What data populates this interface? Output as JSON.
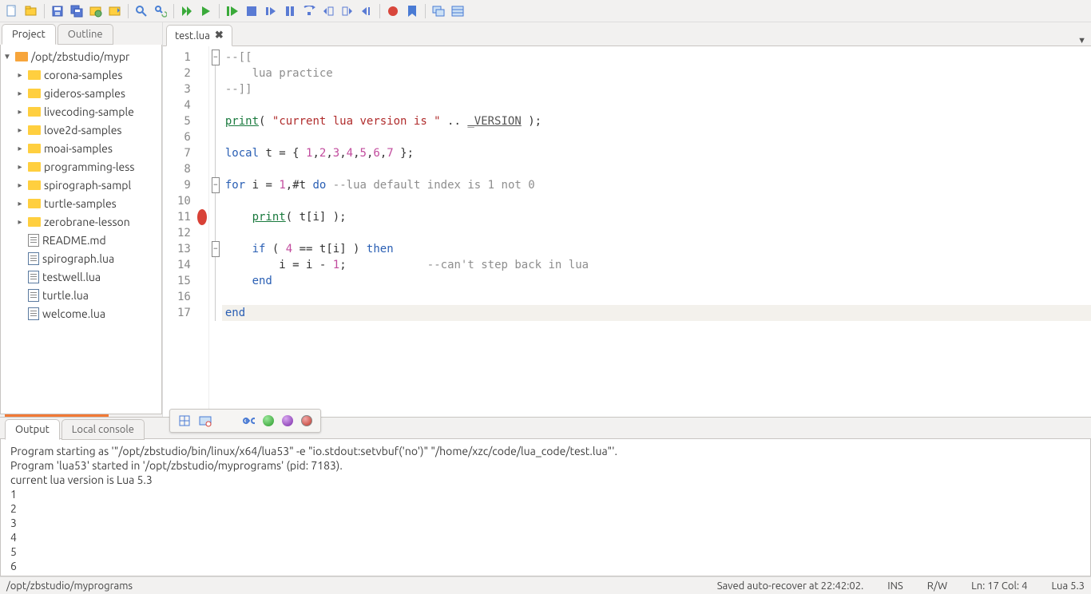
{
  "toolbar_icons": [
    "new-file",
    "open",
    "save",
    "save-all",
    "project",
    "recent",
    "find",
    "find-replace",
    "run",
    "run-no-debug",
    "debug",
    "stop",
    "step-over",
    "step-into",
    "step-out",
    "run-to",
    "toggle-breakpoint",
    "stack",
    "watch",
    "record",
    "bookmark",
    "split",
    "console"
  ],
  "sidebar": {
    "tabs": [
      "Project",
      "Outline"
    ],
    "active_tab": 0,
    "root": "/opt/zbstudio/mypr",
    "folders": [
      "corona-samples",
      "gideros-samples",
      "livecoding-sample",
      "love2d-samples",
      "moai-samples",
      "programming-less",
      "spirograph-sampl",
      "turtle-samples",
      "zerobrane-lesson"
    ],
    "files": [
      {
        "name": "README.md",
        "kind": "md"
      },
      {
        "name": "spirograph.lua",
        "kind": "lua"
      },
      {
        "name": "testwell.lua",
        "kind": "lua"
      },
      {
        "name": "turtle.lua",
        "kind": "lua"
      },
      {
        "name": "welcome.lua",
        "kind": "lua"
      }
    ]
  },
  "editor": {
    "tabs": [
      {
        "label": "test.lua",
        "active": true
      }
    ],
    "breakpoint_line": 11,
    "current_line": 17,
    "fold_markers": {
      "1": "minus",
      "9": "minus",
      "13": "minus"
    },
    "lines": [
      {
        "n": 1,
        "html": "<span class='k-comment'>--[[</span>"
      },
      {
        "n": 2,
        "html": "<span class='k-comment'>    lua practice</span>"
      },
      {
        "n": 3,
        "html": "<span class='k-comment'>--]]</span>"
      },
      {
        "n": 4,
        "html": ""
      },
      {
        "n": 5,
        "html": "<span class='k-func'>print</span><span class='k-ident'>(</span> <span class='k-string'>\"current lua version is \"</span> <span class='k-ident'>..</span> <span class='k-global'>_VERSION</span> <span class='k-ident'>);</span>"
      },
      {
        "n": 6,
        "html": ""
      },
      {
        "n": 7,
        "html": "<span class='k-keyword'>local</span> <span class='k-ident'>t = {</span> <span class='k-number'>1</span><span class='k-ident'>,</span><span class='k-number'>2</span><span class='k-ident'>,</span><span class='k-number'>3</span><span class='k-ident'>,</span><span class='k-number'>4</span><span class='k-ident'>,</span><span class='k-number'>5</span><span class='k-ident'>,</span><span class='k-number'>6</span><span class='k-ident'>,</span><span class='k-number'>7</span> <span class='k-ident'>};</span>"
      },
      {
        "n": 8,
        "html": ""
      },
      {
        "n": 9,
        "html": "<span class='k-keyword'>for</span> <span class='k-ident'>i =</span> <span class='k-number'>1</span><span class='k-ident'>,#t</span> <span class='k-keyword'>do</span> <span class='k-comment'>--lua default index is 1 not 0</span>"
      },
      {
        "n": 10,
        "html": ""
      },
      {
        "n": 11,
        "html": "    <span class='k-func'>print</span><span class='k-ident'>( t[i] );</span>"
      },
      {
        "n": 12,
        "html": ""
      },
      {
        "n": 13,
        "html": "    <span class='k-keyword'>if</span> <span class='k-ident'>(</span> <span class='k-number'>4</span> <span class='k-ident'>== t[i] )</span> <span class='k-keyword'>then</span>"
      },
      {
        "n": 14,
        "html": "        <span class='k-ident'>i = i -</span> <span class='k-number'>1</span><span class='k-ident'>;</span>            <span class='k-comment'>--can't step back in lua</span>"
      },
      {
        "n": 15,
        "html": "    <span class='k-keyword'>end</span>"
      },
      {
        "n": 16,
        "html": ""
      },
      {
        "n": 17,
        "html": "<span class='k-keyword'>end</span>"
      }
    ]
  },
  "debug_balls": [
    "#4aa3e0",
    "#8a6fb5",
    "#3b74c1",
    "#3b74c1",
    "#4cc24c",
    "#9b47c7",
    "#d8463b"
  ],
  "bottom": {
    "tabs": [
      "Output",
      "Local console"
    ],
    "active_tab": 0,
    "lines": [
      "Program starting as '\"/opt/zbstudio/bin/linux/x64/lua53\" -e \"io.stdout:setvbuf('no')\" \"/home/xzc/code/lua_code/test.lua\"'.",
      "Program 'lua53' started in '/opt/zbstudio/myprograms' (pid: 7183).",
      "current lua version is Lua 5.3",
      "1",
      "2",
      "3",
      "4",
      "5",
      "6"
    ]
  },
  "status": {
    "path": "/opt/zbstudio/myprograms",
    "save_msg": "Saved auto-recover at 22:42:02.",
    "ins": "INS",
    "rw": "R/W",
    "pos": "Ln: 17 Col: 4",
    "lang": "Lua 5.3"
  }
}
